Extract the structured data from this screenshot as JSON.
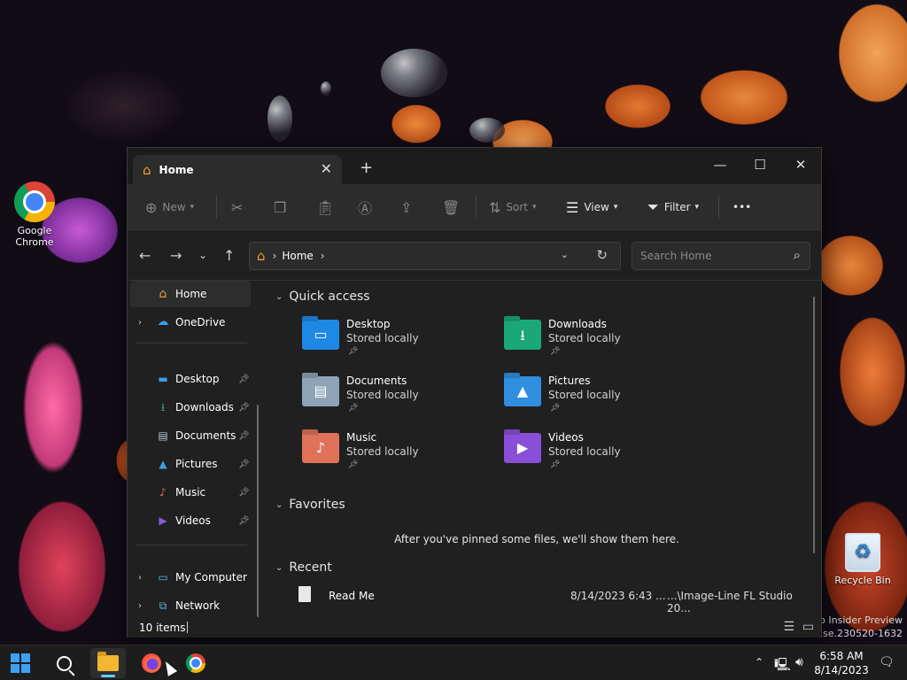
{
  "desktop": {
    "icons": [
      {
        "label": "Google Chrome",
        "icon": "chrome-icon"
      },
      {
        "label": "Recycle Bin",
        "icon": "recycle-bin-icon"
      }
    ],
    "watermark_line1": "ro Insider Preview",
    "watermark_line2": "lease.230520-1632"
  },
  "window": {
    "tab_title": "Home",
    "new_tab": "+",
    "controls": {
      "minimize": "—",
      "maximize": "☐",
      "close": "✕"
    },
    "toolbar": {
      "new_label": "New",
      "sort_label": "Sort",
      "view_label": "View",
      "filter_label": "Filter",
      "more": "•••"
    },
    "address": {
      "crumb": "Home",
      "separator": "›"
    },
    "search_placeholder": "Search Home",
    "sidebar": {
      "home": "Home",
      "onedrive": "OneDrive",
      "pinned": [
        {
          "label": "Desktop",
          "icon": "desktop-folder-icon",
          "color": "#3b9ee6"
        },
        {
          "label": "Downloads",
          "icon": "download-icon",
          "color": "#2bb673"
        },
        {
          "label": "Documents",
          "icon": "document-icon",
          "color": "#b9c4cf"
        },
        {
          "label": "Pictures",
          "icon": "picture-icon",
          "color": "#3b9ee6"
        },
        {
          "label": "Music",
          "icon": "music-icon",
          "color": "#e06b6b"
        },
        {
          "label": "Videos",
          "icon": "video-icon",
          "color": "#8a5ad8"
        }
      ],
      "my_computer": "My Computer",
      "network": "Network"
    },
    "quick_access": {
      "header": "Quick access",
      "items": [
        {
          "name": "Desktop",
          "sub": "Stored locally",
          "icon": "desktop-folder-icon",
          "color": "#1e88e5"
        },
        {
          "name": "Downloads",
          "sub": "Stored locally",
          "icon": "downloads-folder-icon",
          "color": "#1aa877"
        },
        {
          "name": "Documents",
          "sub": "Stored locally",
          "icon": "documents-folder-icon",
          "color": "#8fa3b7"
        },
        {
          "name": "Pictures",
          "sub": "Stored locally",
          "icon": "pictures-folder-icon",
          "color": "#2f8ee0"
        },
        {
          "name": "Music",
          "sub": "Stored locally",
          "icon": "music-folder-icon",
          "color": "#e0725a"
        },
        {
          "name": "Videos",
          "sub": "Stored locally",
          "icon": "videos-folder-icon",
          "color": "#8a4fd8"
        }
      ]
    },
    "favorites": {
      "header": "Favorites",
      "empty_message": "After you've pinned some files, we'll show them here."
    },
    "recent": {
      "header": "Recent",
      "rows": [
        {
          "name": "Read Me",
          "date": "8/14/2023 6:43 ...",
          "path": "...\\Image-Line FL Studio 20..."
        }
      ]
    },
    "status": {
      "count": "10 items"
    }
  },
  "taskbar": {
    "clock_time": "6:58 AM",
    "clock_date": "8/14/2023",
    "accent": "#60cdff"
  }
}
